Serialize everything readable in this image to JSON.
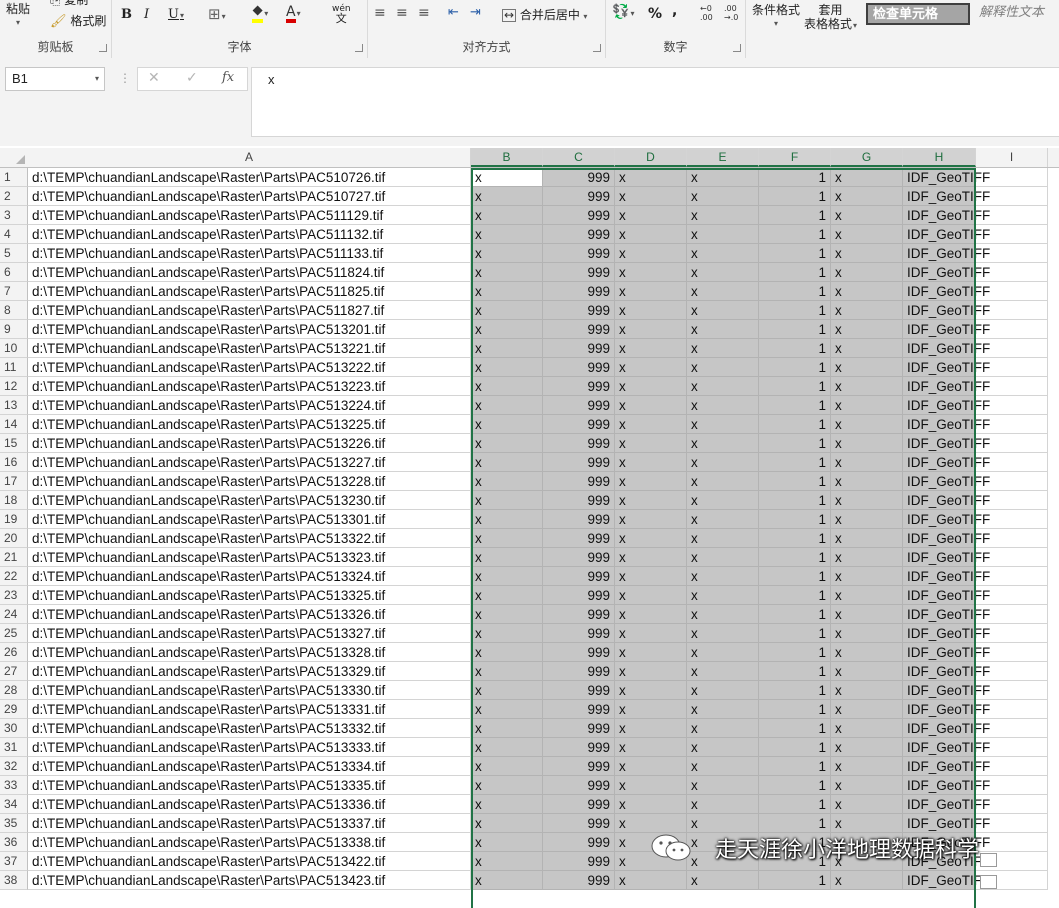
{
  "ribbon": {
    "clipboard": {
      "paste": "粘贴",
      "copy": "复制",
      "format_painter": "格式刷",
      "label": "剪贴板"
    },
    "font": {
      "bold": "B",
      "italic": "I",
      "underline": "U",
      "fill_letter": "⯁",
      "font_color_letter": "A",
      "wen_top": "wén",
      "wen_bottom": "文",
      "label": "字体"
    },
    "alignment": {
      "merge_center": "合并后居中",
      "label": "对齐方式"
    },
    "number": {
      "percent": "%",
      "comma": ",",
      "inc_decimal_top": "←0",
      "inc_decimal_bottom": ".00",
      "dec_decimal_top": ".00",
      "dec_decimal_bottom": "→.0",
      "label": "数字"
    },
    "styles": {
      "conditional_formatting": "条件格式",
      "table_format_line1": "套用",
      "table_format_line2": "表格格式",
      "check_cell": "检查单元格",
      "explanatory_text": "解释性文本"
    }
  },
  "formula_bar": {
    "name_box": "B1",
    "cancel": "✕",
    "enter": "✓",
    "fx": "fx",
    "content": "x"
  },
  "columns": [
    "A",
    "B",
    "C",
    "D",
    "E",
    "F",
    "G",
    "H",
    "I"
  ],
  "rows": [
    {
      "n": "1",
      "a": "d:\\TEMP\\chuandianLandscape\\Raster\\Parts\\PAC510726.tif",
      "b": "x",
      "c": "999",
      "d": "x",
      "e": "x",
      "f": "1",
      "g": "x",
      "h": "IDF_GeoTIFF"
    },
    {
      "n": "2",
      "a": "d:\\TEMP\\chuandianLandscape\\Raster\\Parts\\PAC510727.tif",
      "b": "x",
      "c": "999",
      "d": "x",
      "e": "x",
      "f": "1",
      "g": "x",
      "h": "IDF_GeoTIFF"
    },
    {
      "n": "3",
      "a": "d:\\TEMP\\chuandianLandscape\\Raster\\Parts\\PAC511129.tif",
      "b": "x",
      "c": "999",
      "d": "x",
      "e": "x",
      "f": "1",
      "g": "x",
      "h": "IDF_GeoTIFF"
    },
    {
      "n": "4",
      "a": "d:\\TEMP\\chuandianLandscape\\Raster\\Parts\\PAC511132.tif",
      "b": "x",
      "c": "999",
      "d": "x",
      "e": "x",
      "f": "1",
      "g": "x",
      "h": "IDF_GeoTIFF"
    },
    {
      "n": "5",
      "a": "d:\\TEMP\\chuandianLandscape\\Raster\\Parts\\PAC511133.tif",
      "b": "x",
      "c": "999",
      "d": "x",
      "e": "x",
      "f": "1",
      "g": "x",
      "h": "IDF_GeoTIFF"
    },
    {
      "n": "6",
      "a": "d:\\TEMP\\chuandianLandscape\\Raster\\Parts\\PAC511824.tif",
      "b": "x",
      "c": "999",
      "d": "x",
      "e": "x",
      "f": "1",
      "g": "x",
      "h": "IDF_GeoTIFF"
    },
    {
      "n": "7",
      "a": "d:\\TEMP\\chuandianLandscape\\Raster\\Parts\\PAC511825.tif",
      "b": "x",
      "c": "999",
      "d": "x",
      "e": "x",
      "f": "1",
      "g": "x",
      "h": "IDF_GeoTIFF"
    },
    {
      "n": "8",
      "a": "d:\\TEMP\\chuandianLandscape\\Raster\\Parts\\PAC511827.tif",
      "b": "x",
      "c": "999",
      "d": "x",
      "e": "x",
      "f": "1",
      "g": "x",
      "h": "IDF_GeoTIFF"
    },
    {
      "n": "9",
      "a": "d:\\TEMP\\chuandianLandscape\\Raster\\Parts\\PAC513201.tif",
      "b": "x",
      "c": "999",
      "d": "x",
      "e": "x",
      "f": "1",
      "g": "x",
      "h": "IDF_GeoTIFF"
    },
    {
      "n": "10",
      "a": "d:\\TEMP\\chuandianLandscape\\Raster\\Parts\\PAC513221.tif",
      "b": "x",
      "c": "999",
      "d": "x",
      "e": "x",
      "f": "1",
      "g": "x",
      "h": "IDF_GeoTIFF"
    },
    {
      "n": "11",
      "a": "d:\\TEMP\\chuandianLandscape\\Raster\\Parts\\PAC513222.tif",
      "b": "x",
      "c": "999",
      "d": "x",
      "e": "x",
      "f": "1",
      "g": "x",
      "h": "IDF_GeoTIFF"
    },
    {
      "n": "12",
      "a": "d:\\TEMP\\chuandianLandscape\\Raster\\Parts\\PAC513223.tif",
      "b": "x",
      "c": "999",
      "d": "x",
      "e": "x",
      "f": "1",
      "g": "x",
      "h": "IDF_GeoTIFF"
    },
    {
      "n": "13",
      "a": "d:\\TEMP\\chuandianLandscape\\Raster\\Parts\\PAC513224.tif",
      "b": "x",
      "c": "999",
      "d": "x",
      "e": "x",
      "f": "1",
      "g": "x",
      "h": "IDF_GeoTIFF"
    },
    {
      "n": "14",
      "a": "d:\\TEMP\\chuandianLandscape\\Raster\\Parts\\PAC513225.tif",
      "b": "x",
      "c": "999",
      "d": "x",
      "e": "x",
      "f": "1",
      "g": "x",
      "h": "IDF_GeoTIFF"
    },
    {
      "n": "15",
      "a": "d:\\TEMP\\chuandianLandscape\\Raster\\Parts\\PAC513226.tif",
      "b": "x",
      "c": "999",
      "d": "x",
      "e": "x",
      "f": "1",
      "g": "x",
      "h": "IDF_GeoTIFF"
    },
    {
      "n": "16",
      "a": "d:\\TEMP\\chuandianLandscape\\Raster\\Parts\\PAC513227.tif",
      "b": "x",
      "c": "999",
      "d": "x",
      "e": "x",
      "f": "1",
      "g": "x",
      "h": "IDF_GeoTIFF"
    },
    {
      "n": "17",
      "a": "d:\\TEMP\\chuandianLandscape\\Raster\\Parts\\PAC513228.tif",
      "b": "x",
      "c": "999",
      "d": "x",
      "e": "x",
      "f": "1",
      "g": "x",
      "h": "IDF_GeoTIFF"
    },
    {
      "n": "18",
      "a": "d:\\TEMP\\chuandianLandscape\\Raster\\Parts\\PAC513230.tif",
      "b": "x",
      "c": "999",
      "d": "x",
      "e": "x",
      "f": "1",
      "g": "x",
      "h": "IDF_GeoTIFF"
    },
    {
      "n": "19",
      "a": "d:\\TEMP\\chuandianLandscape\\Raster\\Parts\\PAC513301.tif",
      "b": "x",
      "c": "999",
      "d": "x",
      "e": "x",
      "f": "1",
      "g": "x",
      "h": "IDF_GeoTIFF"
    },
    {
      "n": "20",
      "a": "d:\\TEMP\\chuandianLandscape\\Raster\\Parts\\PAC513322.tif",
      "b": "x",
      "c": "999",
      "d": "x",
      "e": "x",
      "f": "1",
      "g": "x",
      "h": "IDF_GeoTIFF"
    },
    {
      "n": "21",
      "a": "d:\\TEMP\\chuandianLandscape\\Raster\\Parts\\PAC513323.tif",
      "b": "x",
      "c": "999",
      "d": "x",
      "e": "x",
      "f": "1",
      "g": "x",
      "h": "IDF_GeoTIFF"
    },
    {
      "n": "22",
      "a": "d:\\TEMP\\chuandianLandscape\\Raster\\Parts\\PAC513324.tif",
      "b": "x",
      "c": "999",
      "d": "x",
      "e": "x",
      "f": "1",
      "g": "x",
      "h": "IDF_GeoTIFF"
    },
    {
      "n": "23",
      "a": "d:\\TEMP\\chuandianLandscape\\Raster\\Parts\\PAC513325.tif",
      "b": "x",
      "c": "999",
      "d": "x",
      "e": "x",
      "f": "1",
      "g": "x",
      "h": "IDF_GeoTIFF"
    },
    {
      "n": "24",
      "a": "d:\\TEMP\\chuandianLandscape\\Raster\\Parts\\PAC513326.tif",
      "b": "x",
      "c": "999",
      "d": "x",
      "e": "x",
      "f": "1",
      "g": "x",
      "h": "IDF_GeoTIFF"
    },
    {
      "n": "25",
      "a": "d:\\TEMP\\chuandianLandscape\\Raster\\Parts\\PAC513327.tif",
      "b": "x",
      "c": "999",
      "d": "x",
      "e": "x",
      "f": "1",
      "g": "x",
      "h": "IDF_GeoTIFF"
    },
    {
      "n": "26",
      "a": "d:\\TEMP\\chuandianLandscape\\Raster\\Parts\\PAC513328.tif",
      "b": "x",
      "c": "999",
      "d": "x",
      "e": "x",
      "f": "1",
      "g": "x",
      "h": "IDF_GeoTIFF"
    },
    {
      "n": "27",
      "a": "d:\\TEMP\\chuandianLandscape\\Raster\\Parts\\PAC513329.tif",
      "b": "x",
      "c": "999",
      "d": "x",
      "e": "x",
      "f": "1",
      "g": "x",
      "h": "IDF_GeoTIFF"
    },
    {
      "n": "28",
      "a": "d:\\TEMP\\chuandianLandscape\\Raster\\Parts\\PAC513330.tif",
      "b": "x",
      "c": "999",
      "d": "x",
      "e": "x",
      "f": "1",
      "g": "x",
      "h": "IDF_GeoTIFF"
    },
    {
      "n": "29",
      "a": "d:\\TEMP\\chuandianLandscape\\Raster\\Parts\\PAC513331.tif",
      "b": "x",
      "c": "999",
      "d": "x",
      "e": "x",
      "f": "1",
      "g": "x",
      "h": "IDF_GeoTIFF"
    },
    {
      "n": "30",
      "a": "d:\\TEMP\\chuandianLandscape\\Raster\\Parts\\PAC513332.tif",
      "b": "x",
      "c": "999",
      "d": "x",
      "e": "x",
      "f": "1",
      "g": "x",
      "h": "IDF_GeoTIFF"
    },
    {
      "n": "31",
      "a": "d:\\TEMP\\chuandianLandscape\\Raster\\Parts\\PAC513333.tif",
      "b": "x",
      "c": "999",
      "d": "x",
      "e": "x",
      "f": "1",
      "g": "x",
      "h": "IDF_GeoTIFF"
    },
    {
      "n": "32",
      "a": "d:\\TEMP\\chuandianLandscape\\Raster\\Parts\\PAC513334.tif",
      "b": "x",
      "c": "999",
      "d": "x",
      "e": "x",
      "f": "1",
      "g": "x",
      "h": "IDF_GeoTIFF"
    },
    {
      "n": "33",
      "a": "d:\\TEMP\\chuandianLandscape\\Raster\\Parts\\PAC513335.tif",
      "b": "x",
      "c": "999",
      "d": "x",
      "e": "x",
      "f": "1",
      "g": "x",
      "h": "IDF_GeoTIFF"
    },
    {
      "n": "34",
      "a": "d:\\TEMP\\chuandianLandscape\\Raster\\Parts\\PAC513336.tif",
      "b": "x",
      "c": "999",
      "d": "x",
      "e": "x",
      "f": "1",
      "g": "x",
      "h": "IDF_GeoTIFF"
    },
    {
      "n": "35",
      "a": "d:\\TEMP\\chuandianLandscape\\Raster\\Parts\\PAC513337.tif",
      "b": "x",
      "c": "999",
      "d": "x",
      "e": "x",
      "f": "1",
      "g": "x",
      "h": "IDF_GeoTIFF"
    },
    {
      "n": "36",
      "a": "d:\\TEMP\\chuandianLandscape\\Raster\\Parts\\PAC513338.tif",
      "b": "x",
      "c": "999",
      "d": "x",
      "e": "x",
      "f": "1",
      "g": "x",
      "h": "IDF_GeoTIFF"
    },
    {
      "n": "37",
      "a": "d:\\TEMP\\chuandianLandscape\\Raster\\Parts\\PAC513422.tif",
      "b": "x",
      "c": "999",
      "d": "x",
      "e": "x",
      "f": "1",
      "g": "x",
      "h": "IDF_GeoTIFF"
    },
    {
      "n": "38",
      "a": "d:\\TEMP\\chuandianLandscape\\Raster\\Parts\\PAC513423.tif",
      "b": "x",
      "c": "999",
      "d": "x",
      "e": "x",
      "f": "1",
      "g": "x",
      "h": "IDF_GeoTIFF"
    }
  ],
  "watermark": {
    "text": "走天涯徐小洋地理数据科学"
  },
  "colors": {
    "selection_border": "#217346",
    "selection_fill": "#c6c6c6",
    "ribbon_bg": "#f3f3f3"
  }
}
